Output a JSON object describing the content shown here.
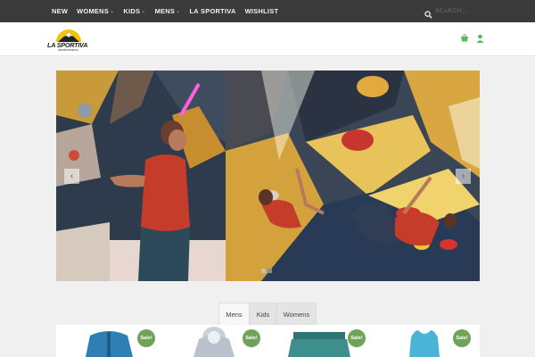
{
  "nav": {
    "items": [
      {
        "label": "NEW",
        "dropdown": false
      },
      {
        "label": "WOMENS",
        "dropdown": true
      },
      {
        "label": "KIDS",
        "dropdown": true
      },
      {
        "label": "MENS",
        "dropdown": true
      },
      {
        "label": "LA SPORTIVA",
        "dropdown": false
      },
      {
        "label": "WISHLIST",
        "dropdown": false
      }
    ],
    "chevron": "⌄"
  },
  "search": {
    "placeholder": "SEARCH...",
    "icon": "search-icon"
  },
  "header": {
    "logo_text": "LA SPORTIVA",
    "logo_subtext": "Akademiskern",
    "cart_icon": "basket-icon",
    "account_icon": "user-icon",
    "accent_color": "#5cb85c"
  },
  "hero": {
    "prev_label": "‹",
    "next_label": "›",
    "slide_count": 2,
    "active_slide": 0
  },
  "tabs": {
    "items": [
      {
        "label": "Mens",
        "active": true
      },
      {
        "label": "Kids",
        "active": false
      },
      {
        "label": "Womens",
        "active": false
      }
    ]
  },
  "products": {
    "sale_label": "Sale!",
    "sale_color": "#6fa35a",
    "items": [
      {
        "name": "blue-jacket",
        "color": "#2f7fb5"
      },
      {
        "name": "grey-hooded-jacket",
        "color": "#b9c2cc"
      },
      {
        "name": "teal-shorts",
        "color": "#3f8e8e"
      },
      {
        "name": "blue-tank-top",
        "color": "#4bb3d6"
      }
    ]
  }
}
